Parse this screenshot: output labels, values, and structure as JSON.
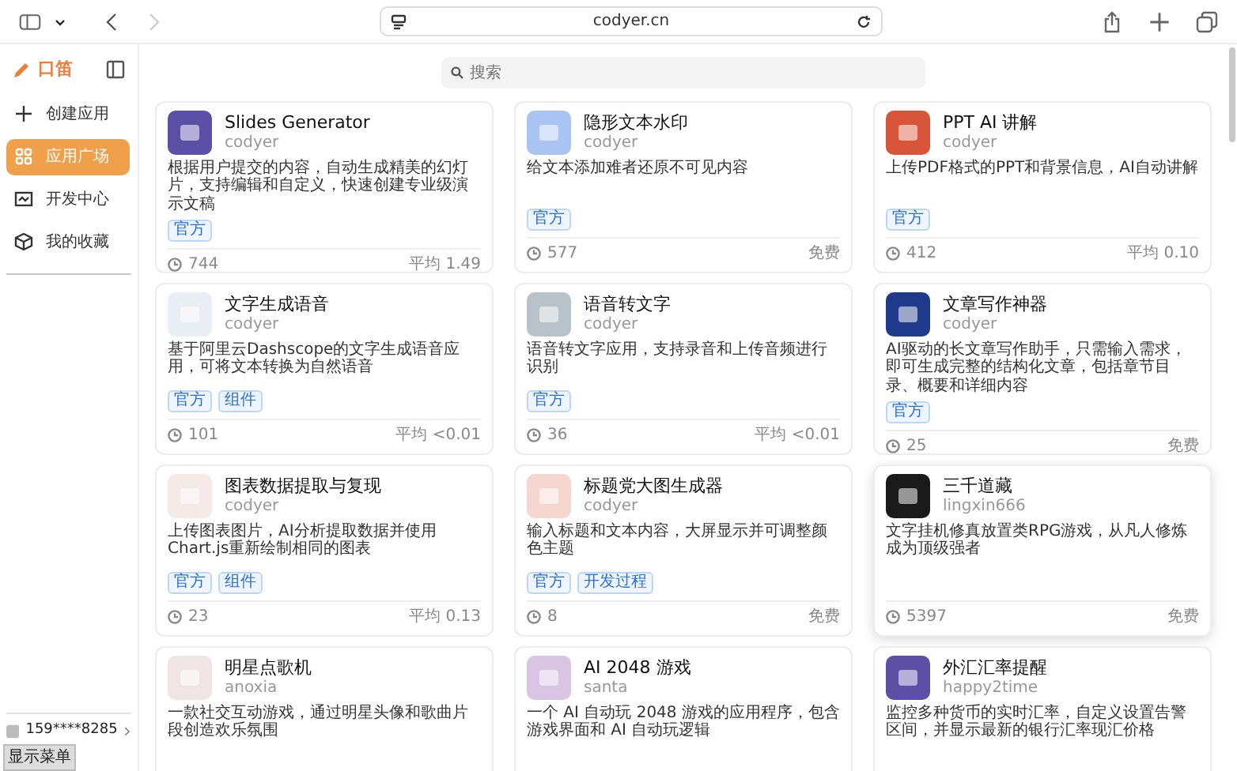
{
  "browser": {
    "url": "codyer.cn",
    "back_enabled": true,
    "forward_enabled": false
  },
  "sidebar": {
    "logo": "口笛",
    "items": [
      {
        "label": "创建应用",
        "selected": false
      },
      {
        "label": "应用广场",
        "selected": true
      },
      {
        "label": "开发中心",
        "selected": false
      },
      {
        "label": "我的收藏",
        "selected": false
      }
    ],
    "user": "159****8285",
    "tooltip": "显示菜单"
  },
  "search": {
    "placeholder": "搜索"
  },
  "apps": [
    {
      "title": "Slides Generator",
      "author": "codyer",
      "description": "根据用户提交的内容，自动生成精美的幻灯片，支持编辑和自定义，快速创建专业级演示文稿",
      "tags": [
        "官方"
      ],
      "uses": "744",
      "price": "平均 1.49",
      "color": "#5b4fa8",
      "highlighted": false
    },
    {
      "title": "隐形文本水印",
      "author": "codyer",
      "description": "给文本添加难者还原不可见内容",
      "tags": [
        "官方"
      ],
      "uses": "577",
      "price": "免费",
      "color": "#a9c4f2",
      "highlighted": false
    },
    {
      "title": "PPT AI 讲解",
      "author": "codyer",
      "description": "上传PDF格式的PPT和背景信息，AI自动讲解",
      "tags": [
        "官方"
      ],
      "uses": "412",
      "price": "平均 0.10",
      "color": "#d9553a",
      "highlighted": false
    },
    {
      "title": "文字生成语音",
      "author": "codyer",
      "description": "基于阿里云Dashscope的文字生成语音应用，可将文本转换为自然语音",
      "tags": [
        "官方",
        "组件"
      ],
      "uses": "101",
      "price": "平均 <0.01",
      "color": "#e8eef3",
      "highlighted": false
    },
    {
      "title": "语音转文字",
      "author": "codyer",
      "description": "语音转文字应用，支持录音和上传音频进行识别",
      "tags": [
        "官方"
      ],
      "uses": "36",
      "price": "平均 <0.01",
      "color": "#b8c2c8",
      "highlighted": false
    },
    {
      "title": "文章写作神器",
      "author": "codyer",
      "description": "AI驱动的长文章写作助手，只需输入需求，即可生成完整的结构化文章，包括章节目录、概要和详细内容",
      "tags": [
        "官方"
      ],
      "uses": "25",
      "price": "免费",
      "color": "#1f3a8a",
      "highlighted": false
    },
    {
      "title": "图表数据提取与复现",
      "author": "codyer",
      "description": "上传图表图片，AI分析提取数据并使用Chart.js重新绘制相同的图表",
      "tags": [
        "官方",
        "组件"
      ],
      "uses": "23",
      "price": "平均 0.13",
      "color": "#f4e9e6",
      "highlighted": false
    },
    {
      "title": "标题党大图生成器",
      "author": "codyer",
      "description": "输入标题和文本内容，大屏显示并可调整颜色主题",
      "tags": [
        "官方",
        "开发过程"
      ],
      "uses": "8",
      "price": "免费",
      "color": "#f6d7cf",
      "highlighted": false
    },
    {
      "title": "三千道藏",
      "author": "lingxin666",
      "description": "文字挂机修真放置类RPG游戏，从凡人修炼成为顶级强者",
      "uses": "5397",
      "price": "免费",
      "color": "#1a1a1a",
      "highlighted": true
    },
    {
      "title": "明星点歌机",
      "author": "anoxia",
      "description": "一款社交互动游戏，通过明星头像和歌曲片段创造欢乐氛围",
      "color": "#f1e4e4",
      "highlighted": false
    },
    {
      "title": "AI 2048 游戏",
      "author": "santa",
      "description": "一个 AI 自动玩 2048 游戏的应用程序，包含游戏界面和 AI 自动玩逻辑",
      "color": "#d9c4e4",
      "highlighted": false
    },
    {
      "title": "外汇汇率提醒",
      "author": "happy2time",
      "description": "监控多种货币的实时汇率，自定义设置告警区间，并显示最新的银行汇率现汇价格",
      "color": "#5d4ea6",
      "highlighted": false
    }
  ]
}
